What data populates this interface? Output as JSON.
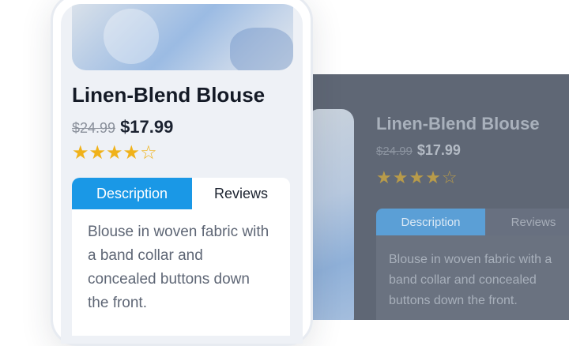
{
  "product": {
    "title": "Linen-Blend Blouse",
    "old_price": "$24.99",
    "price": "$17.99",
    "rating": 4,
    "rating_max": 5,
    "stars_text": "★★★★☆"
  },
  "tabs": [
    {
      "label": "Description",
      "active": true
    },
    {
      "label": "Reviews",
      "active": false
    }
  ],
  "description": "Blouse in woven fabric with a band collar and concealed buttons down the front.",
  "colors": {
    "accent": "#1a98e6",
    "star": "#f0b21a"
  }
}
